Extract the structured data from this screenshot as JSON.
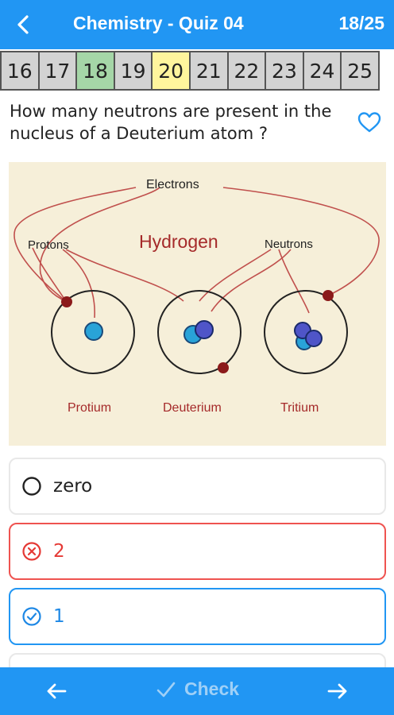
{
  "header": {
    "title": "Chemistry - Quiz 04",
    "counter": "18/25"
  },
  "question_nav": [
    {
      "label": "16",
      "state": "normal"
    },
    {
      "label": "17",
      "state": "normal"
    },
    {
      "label": "18",
      "state": "answered"
    },
    {
      "label": "19",
      "state": "normal"
    },
    {
      "label": "20",
      "state": "current"
    },
    {
      "label": "21",
      "state": "normal"
    },
    {
      "label": "22",
      "state": "normal"
    },
    {
      "label": "23",
      "state": "normal"
    },
    {
      "label": "24",
      "state": "normal"
    },
    {
      "label": "25",
      "state": "normal"
    }
  ],
  "question": {
    "text": "How many neutrons are present in the nucleus of a Deuterium atom ?"
  },
  "figure": {
    "labels": {
      "electrons": "Electrons",
      "protons": "Protons",
      "hydrogen": "Hydrogen",
      "neutrons": "Neutrons",
      "protium": "Protium",
      "deuterium": "Deuterium",
      "tritium": "Tritium"
    }
  },
  "options": [
    {
      "text": "zero",
      "state": "unselected"
    },
    {
      "text": "2",
      "state": "wrong"
    },
    {
      "text": "1",
      "state": "correct"
    },
    {
      "text": "",
      "state": "unselected"
    }
  ],
  "bottom": {
    "check_label": "Check"
  },
  "icons": {
    "back": "arrow-left-icon",
    "favorite": "heart-outline-icon",
    "prev": "arrow-left-icon",
    "next": "arrow-right-icon",
    "check": "checkmark-icon"
  },
  "colors": {
    "primary": "#2196f3",
    "answered": "#a5d6a7",
    "current": "#fff59d",
    "wrong": "#e53935",
    "correct": "#1e88e5",
    "figure_bg": "#f6efd9"
  }
}
